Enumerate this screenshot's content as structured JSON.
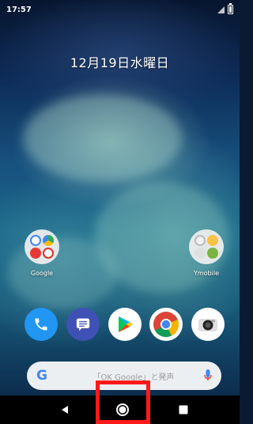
{
  "status_bar": {
    "time": "17:57",
    "signal_icon": "signal-icon",
    "battery_icon": "battery-icon"
  },
  "home": {
    "date": "12月19日水曜日",
    "folders": [
      {
        "label": "Google",
        "icon": "google-folder-icon"
      },
      {
        "label": "Ymobile",
        "icon": "ymobile-folder-icon"
      }
    ],
    "dock": [
      {
        "name": "phone",
        "icon": "phone-icon",
        "color": "#2196f3"
      },
      {
        "name": "messages",
        "icon": "messages-icon",
        "color": "#3f51b5"
      },
      {
        "name": "play-store",
        "icon": "play-store-icon",
        "color": "#ffffff"
      },
      {
        "name": "chrome",
        "icon": "chrome-icon",
        "color": "#ffffff"
      },
      {
        "name": "camera",
        "icon": "camera-icon",
        "color": "#ffffff"
      }
    ],
    "search": {
      "logo": "G",
      "hint": "「OK Google」と発声",
      "mic_icon": "mic-icon"
    }
  },
  "nav_bar": {
    "back_icon": "back-icon",
    "home_icon": "home-icon",
    "recents_icon": "recents-icon",
    "highlight_color": "#ff1a1a"
  }
}
